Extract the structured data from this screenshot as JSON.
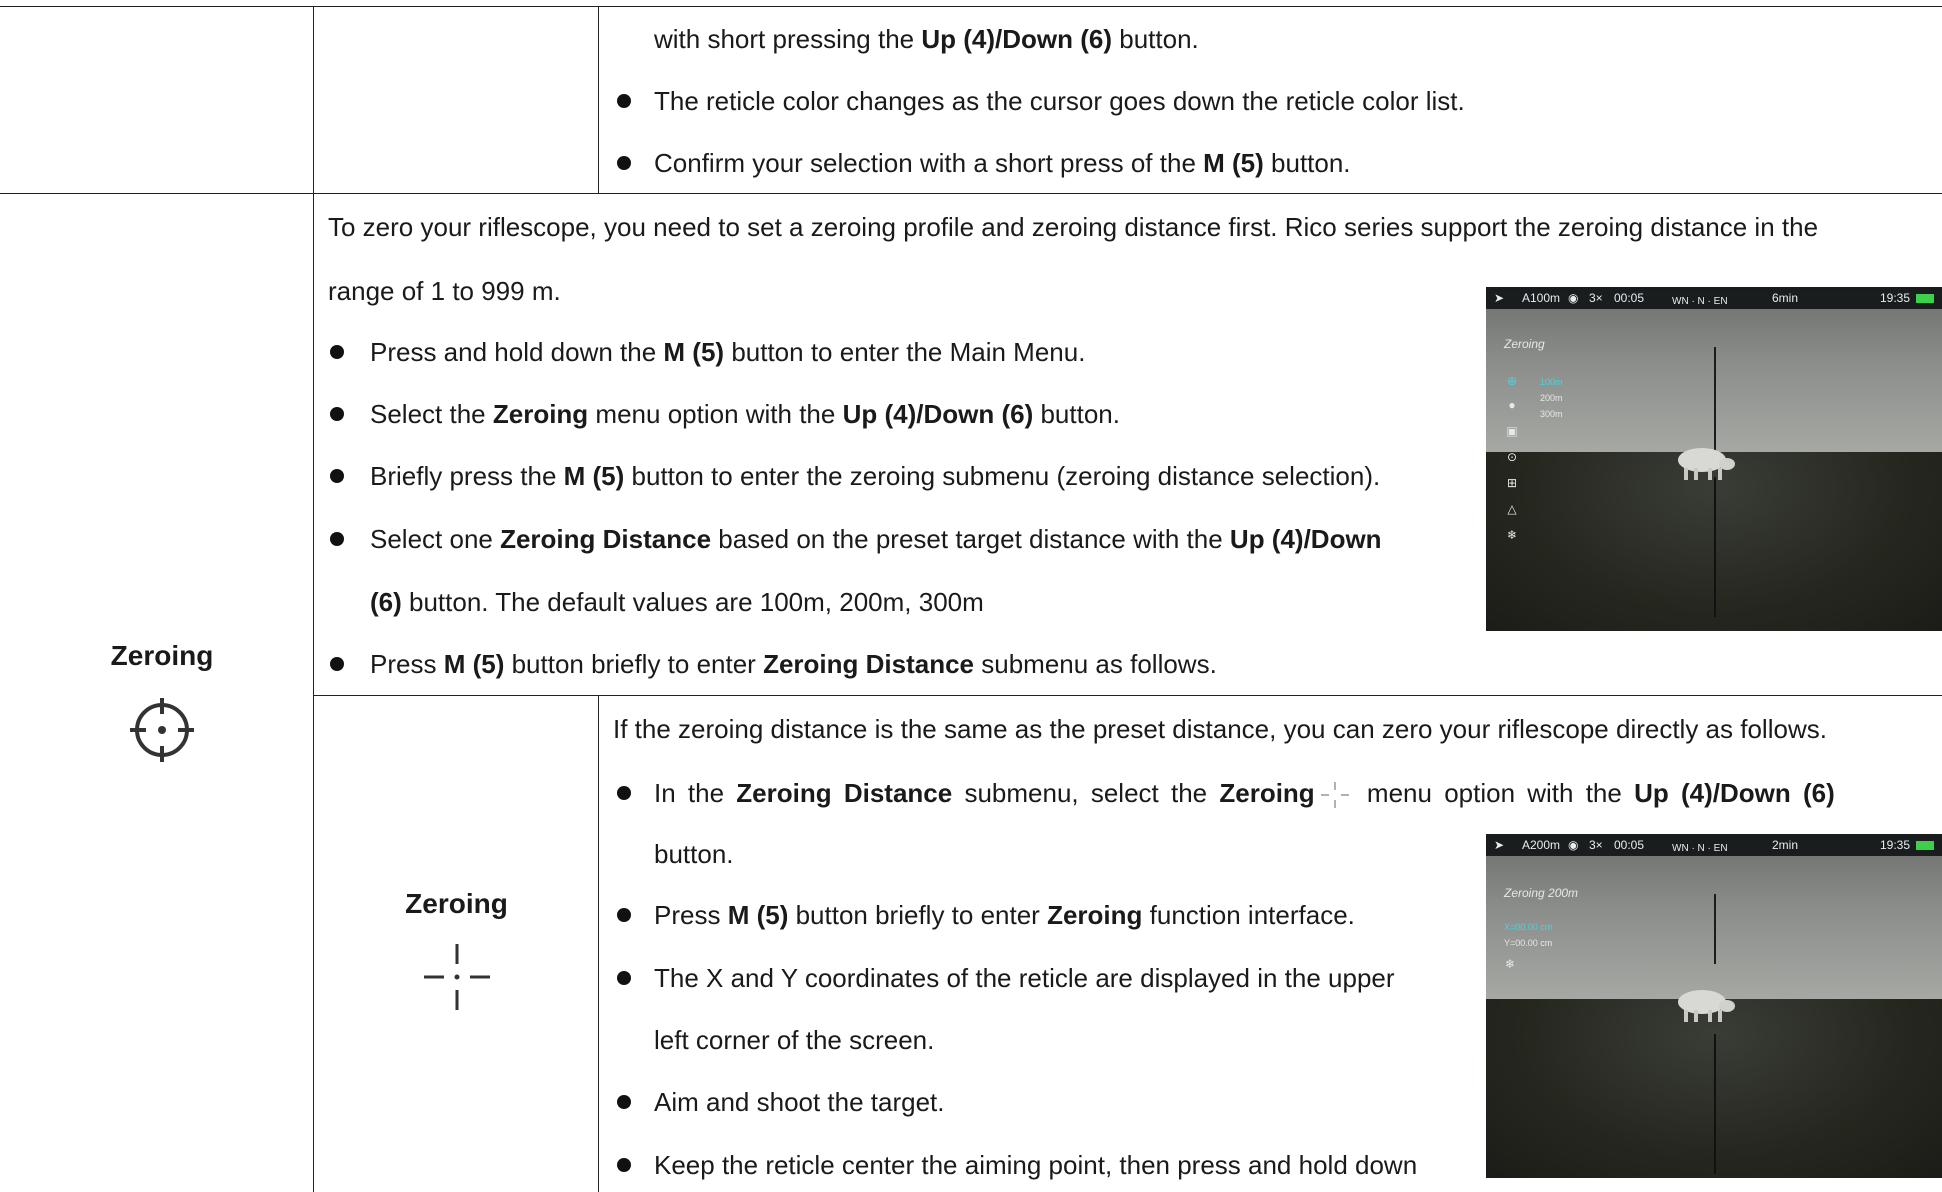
{
  "row1": {
    "line0": [
      "with short pressing the ",
      "Up (4)/Down (6)",
      " button."
    ],
    "bullet1": "The reticle color changes as the cursor goes down the reticle color list.",
    "bullet2": [
      "Confirm your selection with a short press of the ",
      "M (5)",
      " button."
    ]
  },
  "zeroing_row": {
    "label": "Zeroing",
    "icon": "crosshair-circle-icon",
    "intro_line1": "To zero your riflescope, you need to set a zeroing profile and zeroing distance first. Rico series support the zeroing distance in the",
    "intro_line2": "range of 1 to 999 m.",
    "bullets": [
      [
        "Press and hold down the ",
        "M (5)",
        " button to enter the Main Menu."
      ],
      [
        "Select the ",
        "Zeroing",
        " menu option with the ",
        "Up (4)/Down (6)",
        " button."
      ],
      [
        "Briefly press the ",
        "M (5)",
        " button to enter the zeroing submenu (zeroing distance selection)."
      ],
      [
        "Select one ",
        "Zeroing Distance",
        " based on the preset target distance with the ",
        "Up (4)/Down"
      ],
      [
        "Press ",
        "M (5)",
        " button briefly to enter ",
        "Zeroing Distance",
        " submenu as follows."
      ]
    ],
    "bullet4_cont": [
      "(6)",
      " button. The default values are 100m, 200m, 300m"
    ],
    "screen1": {
      "status": {
        "mode": "A100m",
        "zoom": "3×",
        "timer": "00:05",
        "compass": "WN  ·  N  ·  EN",
        "sleep": "6min",
        "time": "19:35"
      },
      "menu_title": "Zeroing",
      "distances": [
        "100m",
        "200m",
        "300m"
      ],
      "selected": "100m"
    }
  },
  "sub_row": {
    "label": "Zeroing",
    "icon": "reticle-cross-icon",
    "intro": "If the zeroing distance is the same as the preset distance, you can zero your riflescope directly as follows.",
    "bullets": [
      [
        "In the ",
        "Zeroing Distance",
        " submenu, select the ",
        "Zeroing",
        " menu option with the ",
        "Up (4)/Down (6)"
      ],
      [
        "Press ",
        "M (5)",
        " button briefly to enter ",
        "Zeroing",
        " function interface."
      ],
      [
        "The X and Y coordinates of the reticle are displayed in the upper"
      ],
      [
        "Aim and shoot the target."
      ],
      [
        "Keep the reticle center the aiming point, then press and hold down"
      ]
    ],
    "bullet1_cont": "button.",
    "bullet3_cont": "left corner of the screen.",
    "screen2": {
      "status": {
        "mode": "A200m",
        "zoom": "3×",
        "timer": "00:05",
        "compass": "WN  ·  N  ·  EN",
        "sleep": "2min",
        "time": "19:35"
      },
      "menu_title": "Zeroing 200m",
      "x_value": "X=00.00 cm",
      "y_value": "Y=00.00 cm"
    }
  }
}
